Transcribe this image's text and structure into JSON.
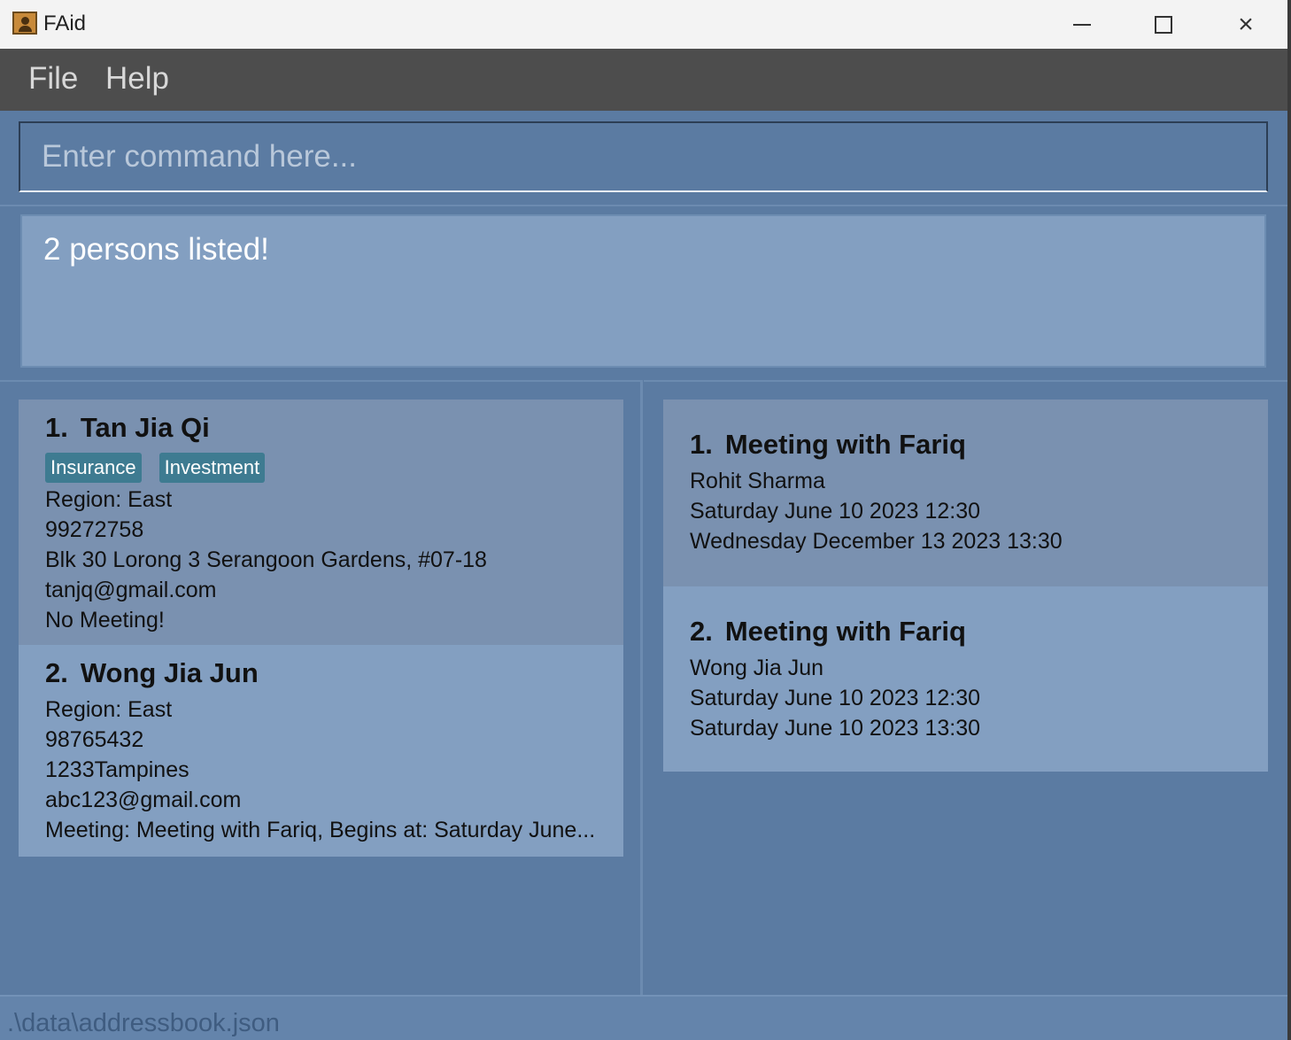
{
  "window": {
    "title": "FAid",
    "icon": "person-card-icon",
    "controls": {
      "minimize": "minimize-icon",
      "maximize": "maximize-icon",
      "close": "×"
    }
  },
  "menubar": {
    "file": "File",
    "help": "Help"
  },
  "command": {
    "placeholder": "Enter command here...",
    "value": ""
  },
  "result": {
    "message": "2 persons listed!"
  },
  "persons": [
    {
      "index": "1.",
      "name": "Tan Jia Qi",
      "tags": [
        "Insurance",
        "Investment"
      ],
      "region": "Region: East",
      "phone": "99272758",
      "address": "Blk 30 Lorong 3 Serangoon Gardens, #07-18",
      "email": "tanjq@gmail.com",
      "meeting": "No Meeting!"
    },
    {
      "index": "2.",
      "name": "Wong Jia Jun",
      "tags": [],
      "region": "Region: East",
      "phone": "98765432",
      "address": "1233Tampines",
      "email": "abc123@gmail.com",
      "meeting": "Meeting: Meeting with Fariq, Begins at: Saturday June..."
    }
  ],
  "meetings": [
    {
      "index": "1.",
      "title": "Meeting with Fariq",
      "attendee": "Rohit Sharma",
      "start": "Saturday June 10 2023 12:30",
      "end": "Wednesday December 13 2023 13:30"
    },
    {
      "index": "2.",
      "title": "Meeting with Fariq",
      "attendee": "Wong Jia Jun",
      "start": "Saturday June 10 2023 12:30",
      "end": "Saturday June 10 2023 13:30"
    }
  ],
  "status": {
    "path": ".\\data\\addressbook.json"
  },
  "colors": {
    "background": "#5b7ba2",
    "menubar": "#4d4d4d",
    "card_dark": "#7a91b0",
    "card_light": "#839fc1",
    "tag": "#3e7b91"
  }
}
